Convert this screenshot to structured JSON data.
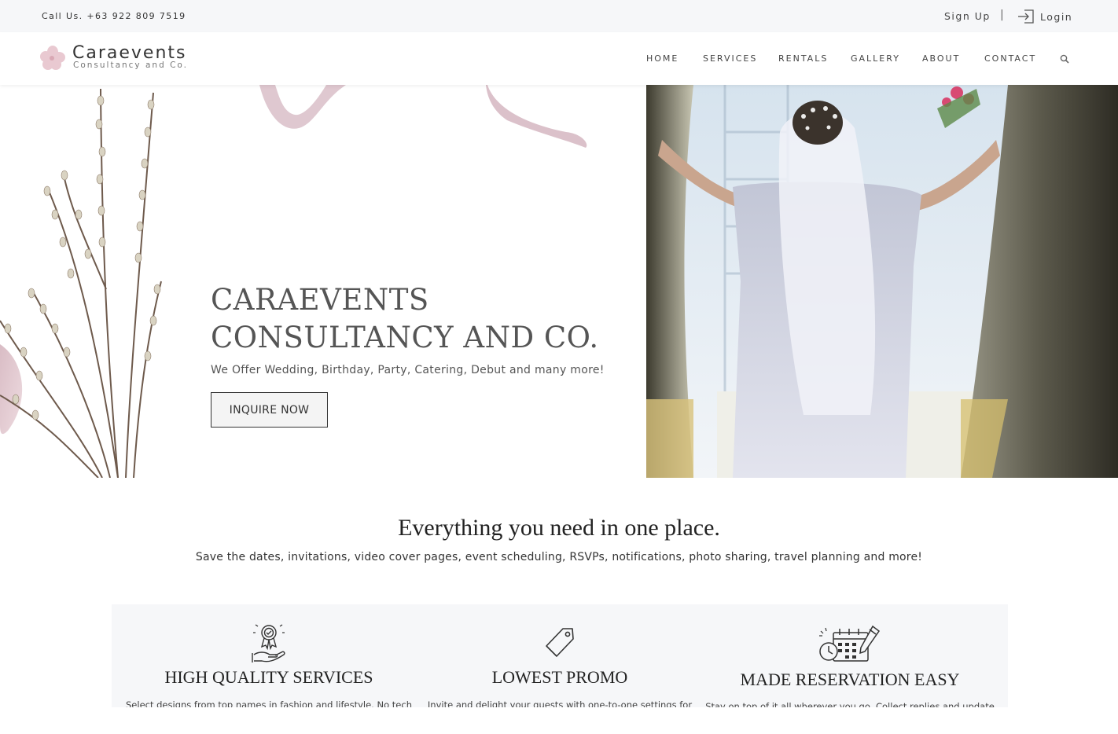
{
  "topbar": {
    "call": "Call Us. +63 922 809 7519",
    "signup": "Sign Up",
    "separator": "|",
    "login": "Login",
    "login_icon": "login-icon"
  },
  "brand": {
    "name": "Caraevents",
    "tagline": "Consultancy and Co.",
    "logo_color": "#e3bfc8"
  },
  "nav": {
    "items": [
      "HOME",
      "SERVICES",
      "RENTALS",
      "GALLERY",
      "ABOUT",
      "CONTACT"
    ],
    "search_icon": "search-icon"
  },
  "hero": {
    "title_line1": "CARAEVENTS",
    "title_line2": "CONSULTANCY AND CO.",
    "subtitle": "We Offer Wedding, Birthday, Party, Catering, Debut and many more!",
    "cta": "INQUIRE NOW"
  },
  "section": {
    "title": "Everything you need in one place.",
    "subtitle": "Save the dates, invitations, video cover pages, event scheduling, RSVPs, notifications, photo sharing, travel planning and more!"
  },
  "features": [
    {
      "icon": "award-hand-icon",
      "title": "HIGH QUALITY SERVICES",
      "desc": "Select designs from top names in fashion and lifestyle. No tech"
    },
    {
      "icon": "price-tag-icon",
      "title": "LOWEST PROMO",
      "desc": "Invite and delight your guests with one-to-one settings for"
    },
    {
      "icon": "calendar-schedule-icon",
      "title": "MADE RESERVATION EASY",
      "desc": "Stay on top of it all wherever you go. Collect replies and update"
    }
  ],
  "colors": {
    "topbar_bg": "#f6f7f9",
    "features_bg": "#f6f7f9",
    "text": "#333333",
    "accent": "#e3bfc8"
  }
}
